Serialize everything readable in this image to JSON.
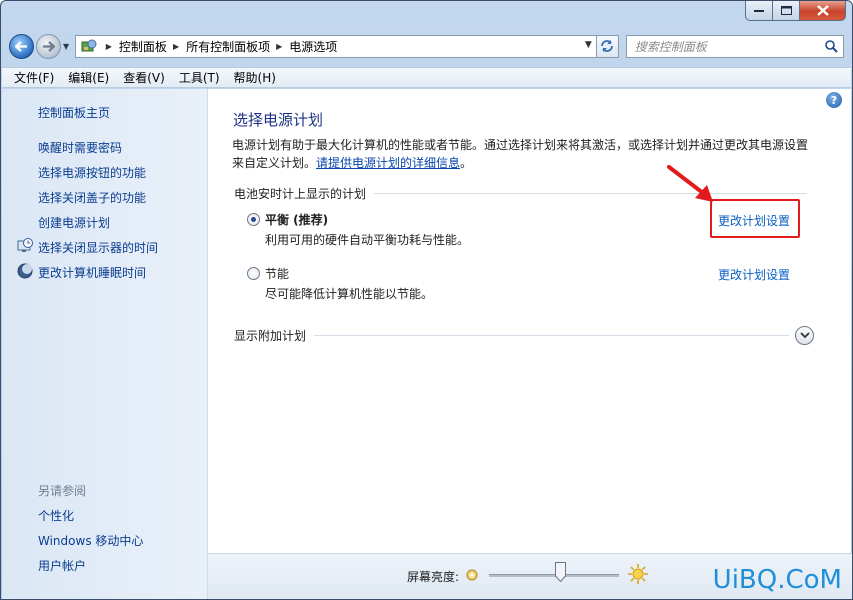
{
  "nav": {
    "breadcrumbs": [
      "控制面板",
      "所有控制面板项",
      "电源选项"
    ],
    "search_placeholder": "搜索控制面板"
  },
  "menu": [
    "文件(F)",
    "编辑(E)",
    "查看(V)",
    "工具(T)",
    "帮助(H)"
  ],
  "sidebar": {
    "home": "控制面板主页",
    "links": [
      "唤醒时需要密码",
      "选择电源按钮的功能",
      "选择关闭盖子的功能",
      "创建电源计划",
      "选择关闭显示器的时间",
      "更改计算机睡眠时间"
    ],
    "see_also_title": "另请参阅",
    "see_also": [
      "个性化",
      "Windows 移动中心",
      "用户帐户"
    ]
  },
  "main": {
    "title": "选择电源计划",
    "description": "电源计划有助于最大化计算机的性能或者节能。通过选择计划来将其激活，或选择计划并通过更改其电源设置来自定义计划。",
    "description_link": "请提供电源计划的详细信息",
    "description_tail": "。",
    "group_header": "电池安时计上显示的计划",
    "plans": [
      {
        "name": "平衡 (推荐)",
        "description": "利用可用的硬件自动平衡功耗与性能。",
        "selected": true,
        "change_link": "更改计划设置"
      },
      {
        "name": "节能",
        "description": "尽可能降低计算机性能以节能。",
        "selected": false,
        "change_link": "更改计划设置"
      }
    ],
    "more_plans": "显示附加计划"
  },
  "bottom": {
    "brightness_label": "屏幕亮度:",
    "brightness_level": 0.55
  },
  "watermark": "UiBQ.CoM",
  "colors": {
    "highlight": "#e11b1b",
    "link": "#0a5fc4"
  }
}
